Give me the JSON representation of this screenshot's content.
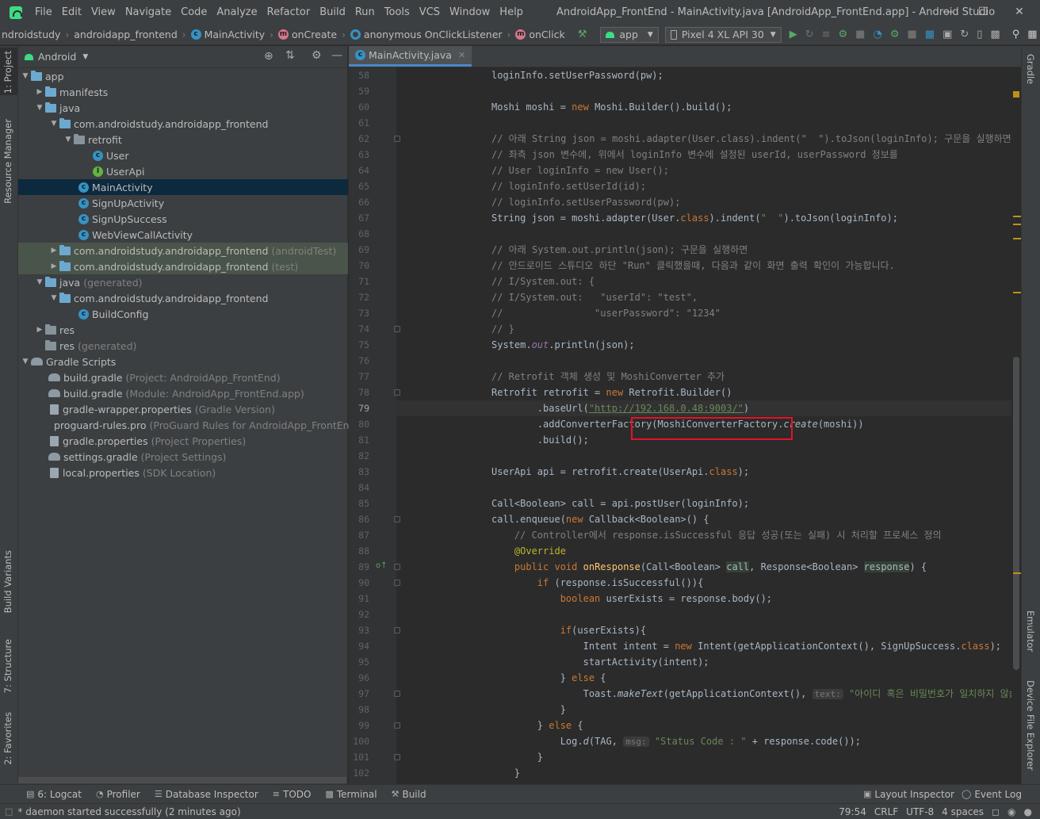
{
  "menubar": {
    "items": [
      "File",
      "Edit",
      "View",
      "Navigate",
      "Code",
      "Analyze",
      "Refactor",
      "Build",
      "Run",
      "Tools",
      "VCS",
      "Window",
      "Help"
    ],
    "title": "AndroidApp_FrontEnd - MainActivity.java [AndroidApp_FrontEnd.app] - Android Studio"
  },
  "navbar": {
    "crumbs": [
      "ndroidstudy",
      "androidapp_frontend",
      "MainActivity",
      "onCreate",
      "anonymous OnClickListener",
      "onClick"
    ],
    "run_config": "app",
    "device": "Pixel 4 XL API 30"
  },
  "left_stripe": {
    "project": "1: Project",
    "resource_manager": "Resource Manager",
    "build_variants": "Build Variants",
    "structure": "7: Structure",
    "favorites": "2: Favorites"
  },
  "right_stripe": {
    "gradle": "Gradle",
    "emulator": "Emulator",
    "device_file_explorer": "Device File Explorer"
  },
  "project_panel": {
    "view_mode": "Android",
    "tree": [
      {
        "label": "app",
        "hint": ""
      },
      {
        "label": "manifests",
        "hint": ""
      },
      {
        "label": "java",
        "hint": ""
      },
      {
        "label": "com.androidstudy.androidapp_frontend",
        "hint": ""
      },
      {
        "label": "retrofit",
        "hint": ""
      },
      {
        "label": "User",
        "hint": ""
      },
      {
        "label": "UserApi",
        "hint": ""
      },
      {
        "label": "MainActivity",
        "hint": ""
      },
      {
        "label": "SignUpActivity",
        "hint": ""
      },
      {
        "label": "SignUpSuccess",
        "hint": ""
      },
      {
        "label": "WebViewCallActivity",
        "hint": ""
      },
      {
        "label": "com.androidstudy.androidapp_frontend",
        "hint": "(androidTest)"
      },
      {
        "label": "com.androidstudy.androidapp_frontend",
        "hint": "(test)"
      },
      {
        "label": "java",
        "hint": "(generated)"
      },
      {
        "label": "com.androidstudy.androidapp_frontend",
        "hint": ""
      },
      {
        "label": "BuildConfig",
        "hint": ""
      },
      {
        "label": "res",
        "hint": ""
      },
      {
        "label": "res",
        "hint": "(generated)"
      },
      {
        "label": "Gradle Scripts",
        "hint": ""
      },
      {
        "label": "build.gradle",
        "hint": "(Project: AndroidApp_FrontEnd)"
      },
      {
        "label": "build.gradle",
        "hint": "(Module: AndroidApp_FrontEnd.app)"
      },
      {
        "label": "gradle-wrapper.properties",
        "hint": "(Gradle Version)"
      },
      {
        "label": "proguard-rules.pro",
        "hint": "(ProGuard Rules for AndroidApp_FrontEnd.app)"
      },
      {
        "label": "gradle.properties",
        "hint": "(Project Properties)"
      },
      {
        "label": "settings.gradle",
        "hint": "(Project Settings)"
      },
      {
        "label": "local.properties",
        "hint": "(SDK Location)"
      }
    ]
  },
  "editor": {
    "tab": "MainActivity.java",
    "line_numbers": [
      "58",
      "59",
      "60",
      "61",
      "62",
      "63",
      "64",
      "65",
      "66",
      "67",
      "68",
      "69",
      "70",
      "71",
      "72",
      "73",
      "74",
      "75",
      "76",
      "77",
      "78",
      "79",
      "80",
      "81",
      "82",
      "83",
      "84",
      "85",
      "86",
      "87",
      "88",
      "89",
      "90",
      "91",
      "92",
      "93",
      "94",
      "95",
      "96",
      "97",
      "98",
      "99",
      "100",
      "101",
      "102"
    ],
    "code": {
      "l58": "loginInfo.setUserPassword(pw);",
      "l60a": "Moshi moshi = ",
      "l60b": "new",
      "l60c": " Moshi.Builder().build();",
      "l62": "// 아래 String json = moshi.adapter(User.class).indent(\"  \").toJson(loginInfo); 구문을 실행하면",
      "l63": "// 좌측 json 변수에, 위에서 loginInfo 변수에 설정된 userId, userPassword 정보를",
      "l64": "// User loginInfo = new User();",
      "l65": "// loginInfo.setUserId(id);",
      "l66": "// loginInfo.setUserPassword(pw);",
      "l67a": "String json = moshi.adapter(User.",
      "l67b": "class",
      "l67c": ").indent(",
      "l67d": "\"  \"",
      "l67e": ").toJson(loginInfo);",
      "l69": "// 아래 System.out.println(json); 구문을 실행하면",
      "l70": "// 안드로이드 스튜디오 하단 \"Run\" 클릭했을때, 다음과 같이 화면 출력 확인이 가능합니다.",
      "l71": "// I/System.out: {",
      "l72": "// I/System.out:   \"userId\": \"test\",",
      "l73": "//                \"userPassword\": \"1234\"",
      "l74": "// }",
      "l75a": "System.",
      "l75b": "out",
      "l75c": ".println(json);",
      "l77": "// Retrofit 객체 생성 및 MoshiConverter 추가",
      "l78a": "Retrofit retrofit = ",
      "l78b": "new",
      "l78c": " Retrofit.Builder()",
      "l79a": "        .baseUrl(",
      "l79b": "\"http://192.168.0.48:9003/\"",
      "l79c": ")",
      "l80a": "        .addConverterFactory(MoshiConverterFactory.",
      "l80b": "create",
      "l80c": "(moshi))",
      "l81": "        .build();",
      "l83a": "UserApi api = retrofit.create(UserApi.",
      "l83b": "class",
      "l83c": ");",
      "l85": "Call<Boolean> call = api.postUser(loginInfo);",
      "l86a": "call.enqueue(",
      "l86b": "new",
      "l86c": " Callback<Boolean>() {",
      "l87": "    // Controller에서 response.isSuccessful 응답 성공(또는 실패) 시 처리할 프로세스 정의",
      "l88": "    @Override",
      "l89a": "    ",
      "l89b": "public void",
      "l89c": " onResponse",
      "l89d": "(Call<Boolean> ",
      "l89e": "call",
      "l89f": ", Response<Boolean> ",
      "l89g": "response",
      "l89h": ") {",
      "l90a": "        ",
      "l90b": "if",
      "l90c": " (response.isSuccessful()){",
      "l91a": "            ",
      "l91b": "boolean",
      "l91c": " userExists = response.body();",
      "l93a": "            ",
      "l93b": "if",
      "l93c": "(userExists){",
      "l94a": "                Intent intent = ",
      "l94b": "new",
      "l94c": " Intent(getApplicationContext(), SignUpSuccess.",
      "l94d": "class",
      "l94e": ");",
      "l95": "                startActivity(intent);",
      "l96a": "            } ",
      "l96b": "else",
      "l96c": " {",
      "l97a": "                Toast.",
      "l97b": "makeText",
      "l97c": "(getApplicationContext(), ",
      "l97d": "text:",
      "l97e": " \"아이디 혹은 비밀번호가 일치하지 않습",
      "l98": "            }",
      "l99a": "        } ",
      "l99b": "else",
      "l99c": " {",
      "l100a": "            Log.",
      "l100b": "d",
      "l100c": "(TAG, ",
      "l100d": "msg:",
      "l100e": " \"Status Code : \"",
      "l100f": " + response.code());",
      "l101": "        }",
      "l102": "    }"
    }
  },
  "bottom_tabs": [
    "6: Logcat",
    "Profiler",
    "Database Inspector",
    "TODO",
    "Terminal",
    "Build"
  ],
  "bottom_right_tabs": [
    "Layout Inspector",
    "Event Log"
  ],
  "status": {
    "message": "* daemon started successfully (2 minutes ago)",
    "position": "79:54",
    "line_sep": "CRLF",
    "encoding": "UTF-8",
    "indent": "4 spaces"
  },
  "colors": {
    "keyword": "#cc7832",
    "string": "#6a8759",
    "comment": "#808080",
    "highlight_box": "#e81123",
    "selection": "#0d293e"
  }
}
